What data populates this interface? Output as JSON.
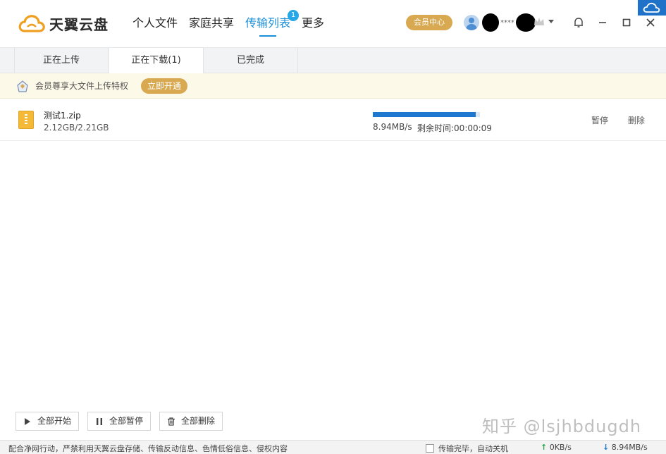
{
  "app": {
    "logo_text": "天翼云盘",
    "brand_color": "#f0a020"
  },
  "nav": {
    "items": [
      {
        "label": "个人文件"
      },
      {
        "label": "家庭共享"
      },
      {
        "label": "传输列表",
        "badge": "1"
      },
      {
        "label": "更多"
      }
    ],
    "active_index": 2,
    "accent_color": "#1c8fd8"
  },
  "header": {
    "vip_center": "会员中心",
    "user_masked": "****"
  },
  "tabs": {
    "items": [
      {
        "label": "正在上传"
      },
      {
        "label": "正在下载(1)"
      },
      {
        "label": "已完成"
      }
    ],
    "active_index": 1
  },
  "promo": {
    "text": "会员尊享大文件上传特权",
    "button": "立即开通",
    "button_color": "#d8a951"
  },
  "downloads": [
    {
      "name": "测试1.zip",
      "size": "2.12GB/2.21GB",
      "progress_fraction": 0.96,
      "speed": "8.94MB/s",
      "remaining": "剩余时间:00:00:09",
      "pause_label": "暂停",
      "delete_label": "删除"
    }
  ],
  "bulk_actions": {
    "start_all": "全部开始",
    "pause_all": "全部暂停",
    "delete_all": "全部删除"
  },
  "watermark": "知乎 @lsjhbdugdh",
  "status": {
    "notice": "配合净网行动，严禁利用天翼云盘存储、传输反动信息、色情低俗信息、侵权内容",
    "auto_shutdown": "传输完毕，自动关机",
    "upload_speed": "0KB/s",
    "download_speed": "8.94MB/s"
  }
}
